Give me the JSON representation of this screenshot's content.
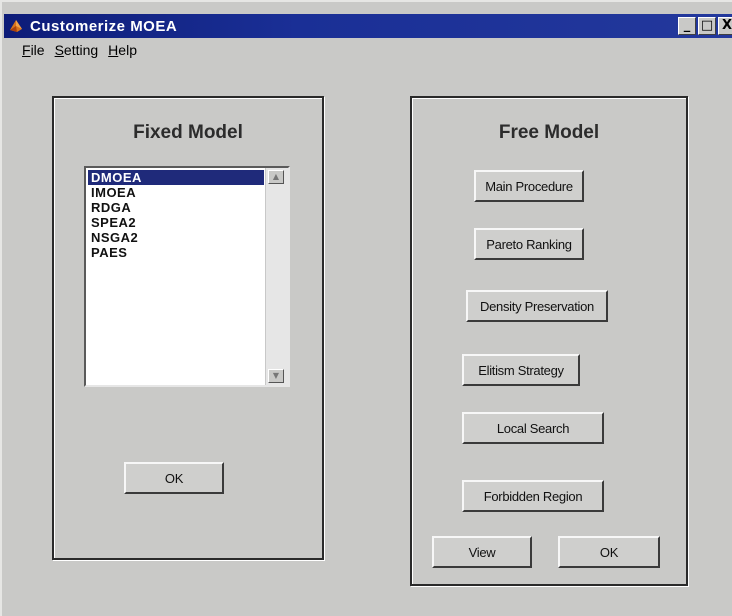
{
  "window": {
    "title": "Customerize MOEA",
    "min_glyph": "_",
    "max_glyph": "□",
    "close_glyph": "X"
  },
  "menu": {
    "items": [
      {
        "accel": "F",
        "rest": "ile"
      },
      {
        "accel": "S",
        "rest": "etting"
      },
      {
        "accel": "H",
        "rest": "elp"
      }
    ]
  },
  "fixed_model": {
    "title": "Fixed Model",
    "list": [
      "DMOEA",
      "IMOEA",
      "RDGA",
      "SPEA2",
      "NSGA2",
      "PAES"
    ],
    "selected": "DMOEA",
    "ok_label": "OK",
    "scroll_up": "▲",
    "scroll_down": "▼"
  },
  "free_model": {
    "title": "Free Model",
    "buttons": {
      "main_procedure": "Main Procedure",
      "pareto_ranking": "Pareto Ranking",
      "density_preservation": "Density Preservation",
      "elitism_strategy": "Elitism Strategy",
      "local_search": "Local Search",
      "forbidden_region": "Forbidden Region"
    },
    "view_label": "View",
    "ok_label": "OK"
  },
  "colors": {
    "titlebar": "#1a2f96",
    "selection": "#1f2a7a",
    "dialog_bg": "#c9c9c7"
  }
}
